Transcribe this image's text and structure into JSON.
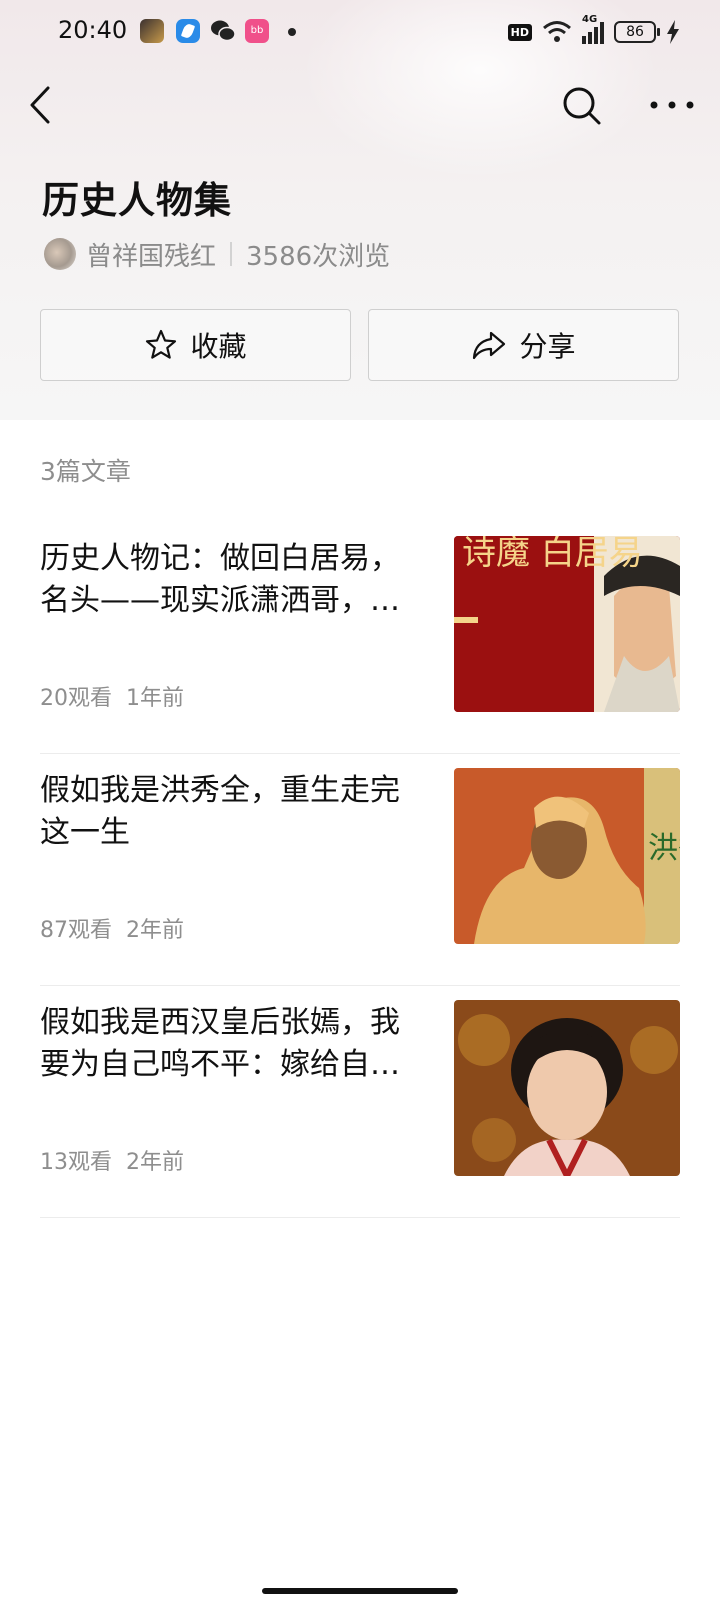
{
  "status_bar": {
    "time": "20:40",
    "battery": "86",
    "network": "4G",
    "hd": "HD"
  },
  "nav": {
    "back_icon": "chevron-left-icon",
    "search_icon": "search-icon",
    "more_icon": "more-horizontal-icon"
  },
  "collection": {
    "title": "历史人物集",
    "author": "曾祥国残红",
    "views": "3586次浏览",
    "favorite_label": "收藏",
    "share_label": "分享",
    "article_count": "3篇文章"
  },
  "articles": [
    {
      "title": "历史人物记：做回白居易，名头——现实派潇洒哥，…",
      "views": "20观看",
      "time": "1年前",
      "thumb_text": "诗魔 白居易"
    },
    {
      "title": "假如我是洪秀全，重生走完这一生",
      "views": "87观看",
      "time": "2年前",
      "thumb_text": "洪秀"
    },
    {
      "title": "假如我是西汉皇后张嫣，我要为自己鸣不平：嫁给自…",
      "views": "13观看",
      "time": "2年前"
    }
  ],
  "colors": {
    "accent_text": "#111111",
    "muted_text": "#8e8e8e",
    "border": "#cfcfcf"
  }
}
